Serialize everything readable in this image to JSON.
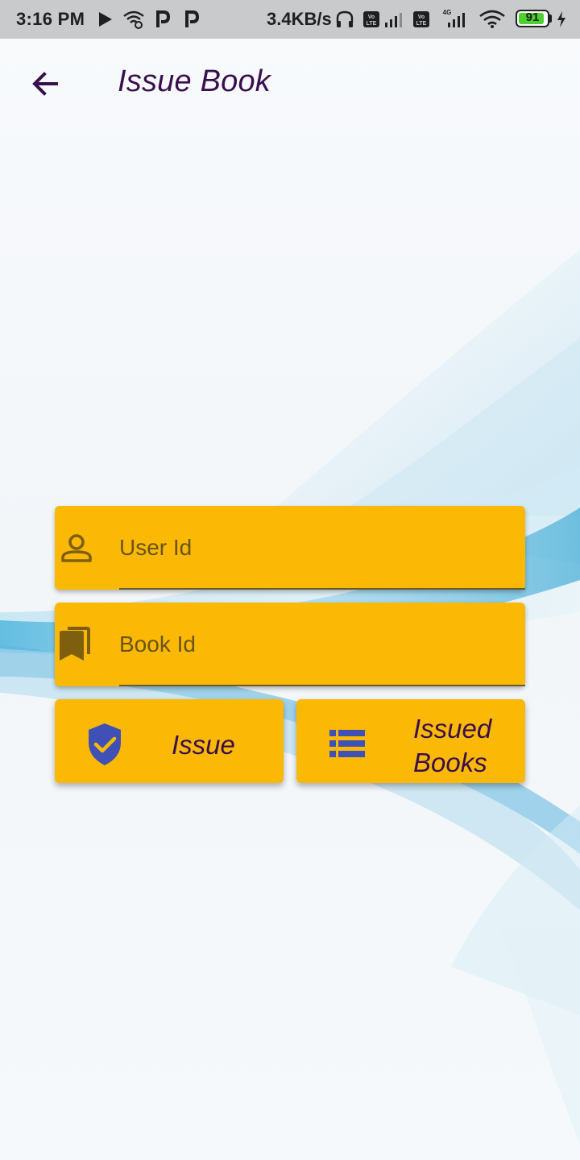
{
  "status_bar": {
    "time": "3:16 PM",
    "network_speed": "3.4KB/s",
    "battery_level": "91",
    "battery_fraction": 0.91
  },
  "app_bar": {
    "title": "Issue Book",
    "back_icon": "arrow-back-icon"
  },
  "form": {
    "user_id": {
      "placeholder": "User Id",
      "value": "",
      "icon": "person-icon"
    },
    "book_id": {
      "placeholder": "Book Id",
      "value": "",
      "icon": "bookmarks-icon"
    }
  },
  "actions": {
    "issue": {
      "label": "Issue",
      "icon": "verified-shield-icon"
    },
    "issued_books": {
      "label_line1": "Issued",
      "label_line2": "Books",
      "icon": "list-icon"
    }
  },
  "colors": {
    "status_bar": "#c9cacc",
    "accent_yellow": "#fbb804",
    "title_purple": "#3a0f4e",
    "icon_blue": "#3f51b5",
    "field_text": "#6a5417",
    "field_icon": "#7d5f0e"
  }
}
